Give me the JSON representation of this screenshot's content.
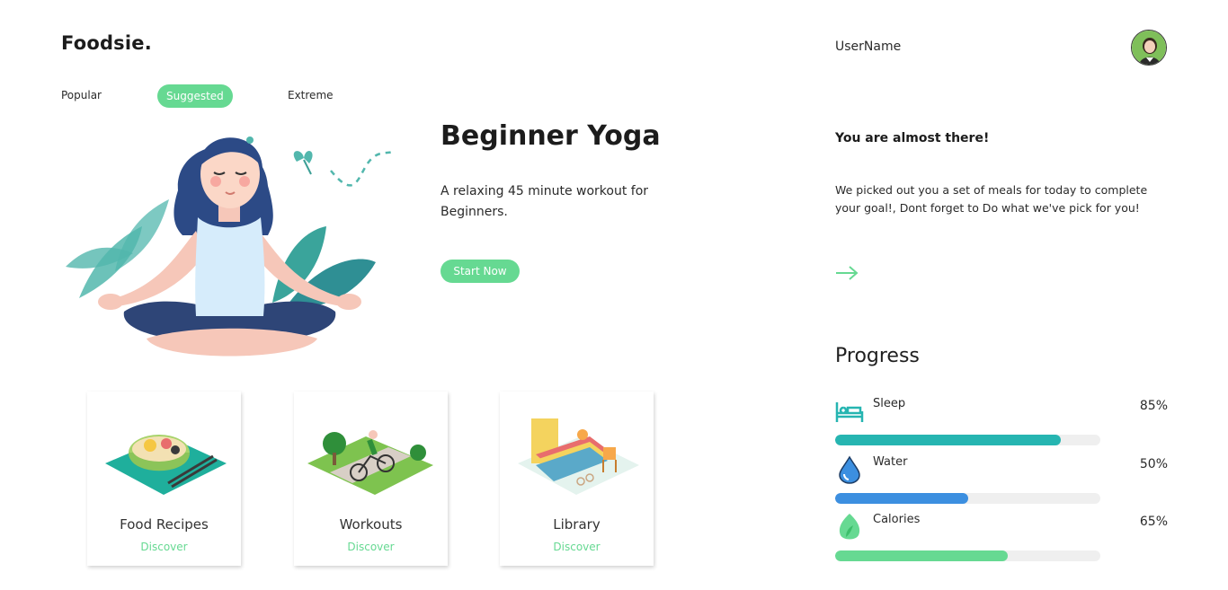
{
  "brand": {
    "logo": "Foodsie."
  },
  "tabs": [
    {
      "label": "Popular",
      "active": false
    },
    {
      "label": "Suggested",
      "active": true
    },
    {
      "label": "Extreme",
      "active": false
    }
  ],
  "hero": {
    "title": "Beginner Yoga",
    "description": "A relaxing 45 minute workout for Beginners.",
    "cta_label": "Start Now",
    "illustration": "meditating-woman-illustration"
  },
  "cards": [
    {
      "title": "Food Recipes",
      "link": "Discover",
      "icon": "food-bowl-illustration"
    },
    {
      "title": "Workouts",
      "link": "Discover",
      "icon": "cycling-park-illustration"
    },
    {
      "title": "Library",
      "link": "Discover",
      "icon": "books-reading-illustration"
    }
  ],
  "user": {
    "name": "UserName",
    "avatar": "user-avatar"
  },
  "promo": {
    "title": "You are almost there!",
    "text": "We picked out you a set of meals for today to complete your goal!, Dont forget to Do what we've pick for you!",
    "arrow_icon": "arrow-right-icon"
  },
  "progress": {
    "title": "Progress",
    "items": [
      {
        "label": "Sleep",
        "value_text": "85%",
        "fraction": 0.85,
        "color": "#26b5b1",
        "icon": "bed-icon"
      },
      {
        "label": "Water",
        "value_text": "50%",
        "fraction": 0.5,
        "color": "#3c8fe0",
        "icon": "water-drop-icon"
      },
      {
        "label": "Calories",
        "value_text": "65%",
        "fraction": 0.65,
        "color": "#66d992",
        "icon": "leaf-icon"
      }
    ]
  },
  "colors": {
    "accent": "#66d992",
    "text": "#1f1f1f"
  }
}
